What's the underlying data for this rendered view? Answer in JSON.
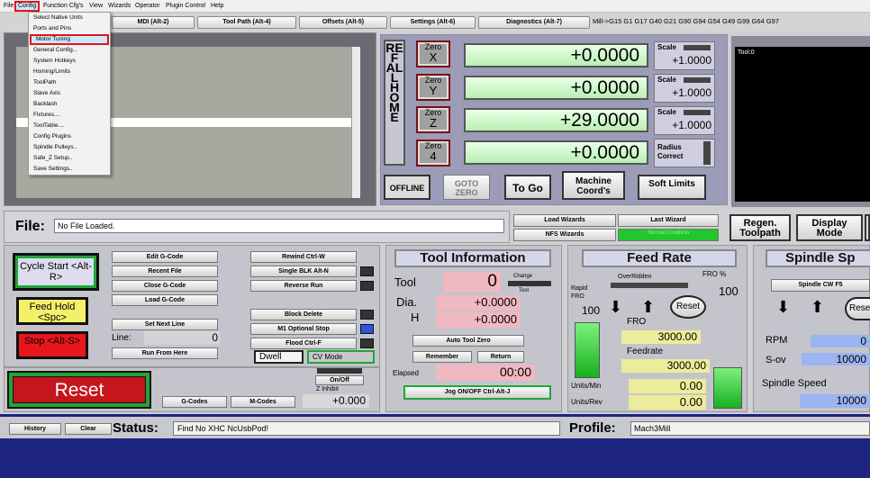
{
  "menu": {
    "items": [
      "File",
      "Config",
      "Function Cfg's",
      "View",
      "Wizards",
      "Operator",
      "Plugin Control",
      "Help"
    ]
  },
  "config_menu": {
    "items": [
      "Select Native Units",
      "Ports and Pins",
      "Motor Tuning",
      "General Config...",
      "System Hotkeys",
      "Homing/Limits",
      "ToolPath",
      "Slave Axis",
      "Backlash",
      "Fixtures....",
      "ToolTable....",
      "Config Plugins",
      "Spindle Pulleys..",
      "Safe_Z Setup..",
      "Save Settings.."
    ]
  },
  "tabs": {
    "mdi": "MDI (Alt-2)",
    "toolpath": "Tool Path (Alt-4)",
    "offsets": "Offsets (Alt-5)",
    "settings": "Settings (Alt-6)",
    "diagnostics": "Diagnostics (Alt-7)"
  },
  "active_gcodes": "Mill->G15  G1 G17 G40 G21 G90 G94 G54 G49 G99 G64 G97",
  "ref_all_home": "REF ALL HOME",
  "axes": [
    {
      "zero_label": "Zero",
      "axis": "X",
      "dro": "+0.0000",
      "scale_label": "Scale",
      "scale": "+1.0000"
    },
    {
      "zero_label": "Zero",
      "axis": "Y",
      "dro": "+0.0000",
      "scale_label": "Scale",
      "scale": "+1.0000"
    },
    {
      "zero_label": "Zero",
      "axis": "Z",
      "dro": "+29.0000",
      "scale_label": "Scale",
      "scale": "+1.0000"
    },
    {
      "zero_label": "Zero",
      "axis": "4",
      "dro": "+0.0000",
      "scale_label": "Radius Correct",
      "scale": ""
    }
  ],
  "dro_buttons": {
    "offline": "OFFLINE",
    "goto_zero": "GOTO ZERO",
    "to_go": "To Go",
    "machine_coords": "Machine Coord's",
    "soft_limits": "Soft Limits"
  },
  "tool_display": {
    "label": "Tool:0"
  },
  "file": {
    "label": "File:",
    "value": "No File Loaded."
  },
  "wizards": {
    "load": "Load Wizards",
    "last": "Last Wizard",
    "nfs": "NFS Wizards",
    "normal": "Normal Condition"
  },
  "toolpath_buttons": {
    "regen": "Regen. Toolpath",
    "display_mode": "Display Mode"
  },
  "program": {
    "cycle_start": "Cycle Start <Alt-R>",
    "feed_hold": "Feed Hold <Spc>",
    "stop": "Stop <Alt-S>",
    "edit": "Edit G-Code",
    "recent": "Recent File",
    "close": "Close G-Code",
    "load": "Load G-Code",
    "set_next": "Set Next Line",
    "line_label": "Line:",
    "line_value": "0",
    "run_from": "Run From Here",
    "rewind": "Rewind Ctrl-W",
    "single_blk": "Single BLK Alt-N",
    "reverse": "Reverse Run",
    "block_delete": "Block Delete",
    "m1_stop": "M1 Optional Stop",
    "flood": "Flood Ctrl-F",
    "dwell": "Dwell",
    "cv_mode": "CV Mode"
  },
  "reset": {
    "label": "Reset",
    "gcodes": "G-Codes",
    "mcodes": "M-Codes",
    "onoff": "On/Off",
    "z_inhibit": "Z Inhibit",
    "z_value": "+0.000"
  },
  "tool_info": {
    "title": "Tool Information",
    "tool_label": "Tool",
    "tool_value": "0",
    "change": "Change",
    "tool_sub": "Tool",
    "dia_label": "Dia.",
    "dia_value": "+0.0000",
    "h_label": "H",
    "h_value": "+0.0000",
    "auto_zero": "Auto Tool Zero",
    "remember": "Remember",
    "return": "Return",
    "elapsed_label": "Elapsed",
    "elapsed_value": "00:00",
    "jog": "Jog ON/OFF Ctrl-Alt-J"
  },
  "feed_rate": {
    "title": "Feed Rate",
    "overridden": "OverRidden",
    "fro_pct_label": "FRO %",
    "fro_pct": "100",
    "rapid_fro": "Rapid FRO",
    "rapid_value": "100",
    "reset": "Reset",
    "fro_label": "FRO",
    "fro_value": "3000.00",
    "feedrate_label": "Feedrate",
    "feedrate_value": "3000.00",
    "units_min_label": "Units/Min",
    "units_min": "0.00",
    "units_rev_label": "Units/Rev",
    "units_rev": "0.00"
  },
  "spindle": {
    "title": "Spindle Sp",
    "cw": "Spindle CW F5",
    "reset": "Rese",
    "rpm_label": "RPM",
    "rpm": "0",
    "sov_label": "S-ov",
    "sov": "10000",
    "speed_label": "Spindle Speed",
    "speed": "10000"
  },
  "status": {
    "history": "History",
    "clear": "Clear",
    "label": "Status:",
    "message": "Find No XHC NcUsbPod!",
    "profile_label": "Profile:",
    "profile": "Mach3Mill"
  }
}
